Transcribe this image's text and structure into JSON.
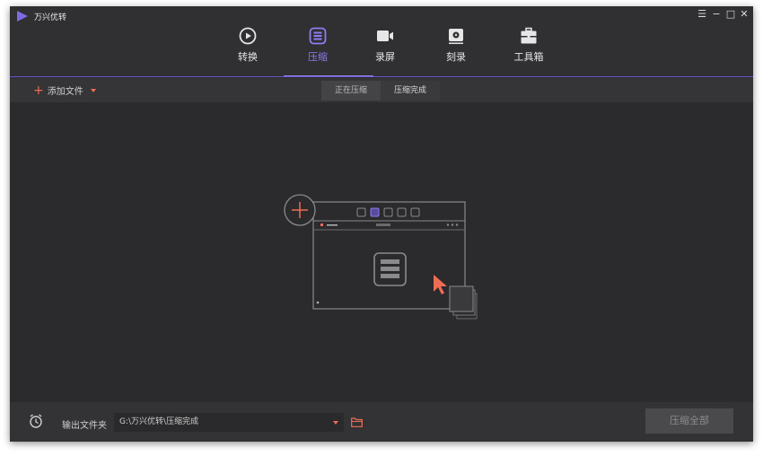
{
  "app": {
    "name": "万兴优转"
  },
  "window_controls": {
    "menu": "☰",
    "minimize": "−",
    "maximize": "□",
    "close": "✕"
  },
  "nav": [
    {
      "label": "转换",
      "icon": "convert-icon"
    },
    {
      "label": "压缩",
      "icon": "compress-icon",
      "active": true
    },
    {
      "label": "录屏",
      "icon": "record-icon"
    },
    {
      "label": "刻录",
      "icon": "burn-disc-icon"
    },
    {
      "label": "工具箱",
      "icon": "toolbox-icon"
    }
  ],
  "toolbar": {
    "add_file": "添加文件",
    "tabs": [
      "正在压缩",
      "压缩完成"
    ]
  },
  "footer": {
    "output_label": "输出文件夹",
    "output_path": "G:\\万兴优转\\压缩完成",
    "compress_all": "压缩全部"
  },
  "colors": {
    "accent": "#8e7cf2",
    "orange": "#ef6d54",
    "bg": "#2b2a2c"
  }
}
